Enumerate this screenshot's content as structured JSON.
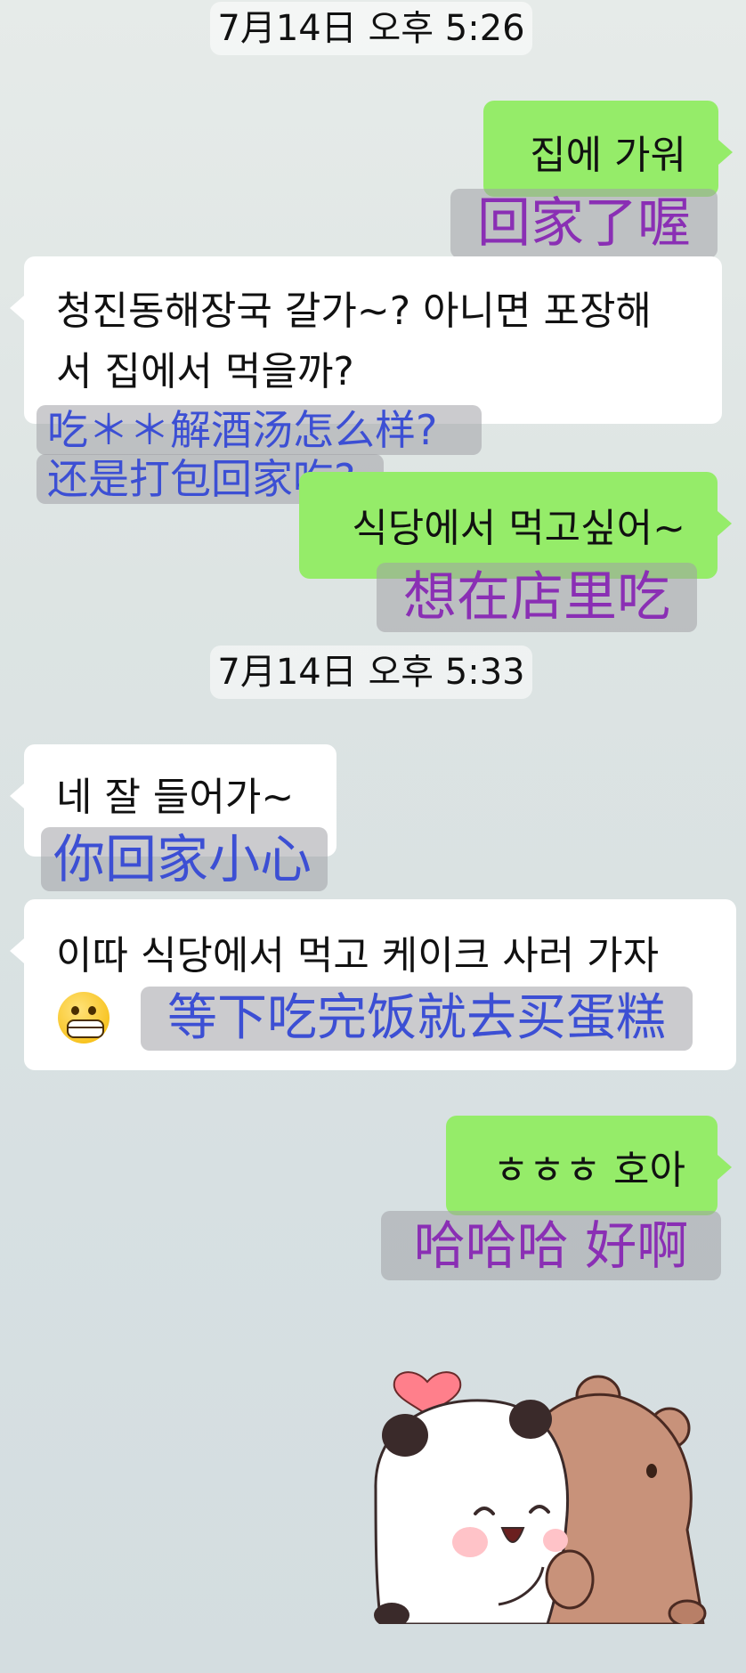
{
  "timestamps": [
    "7月14日 오후 5:26",
    "7月14日 오후 5:33"
  ],
  "messages": [
    {
      "side": "me",
      "text": "집에 가워",
      "translation": "回家了喔"
    },
    {
      "side": "them",
      "text_line1": "청진동해장국 갈가~? 아니면 포장해",
      "text_line2": "서 집에서 먹을까?",
      "translation_line1": "吃＊＊解酒汤怎么样?",
      "translation_line2": "还是打包回家吃?"
    },
    {
      "side": "me",
      "text": "식당에서 먹고싶어~",
      "translation": "想在店里吃"
    },
    {
      "side": "them",
      "text": "네 잘 들어가~",
      "translation": "你回家小心"
    },
    {
      "side": "them",
      "text": "이따 식당에서 먹고 케이크 사러 가자",
      "emoji": "grimacing-face-icon",
      "translation": "等下吃完饭就去买蛋糕"
    },
    {
      "side": "me",
      "text": "ㅎㅎㅎ 호아",
      "translation": "哈哈哈 好啊"
    }
  ],
  "sticker": "panda-and-bear-hug-sticker",
  "colors": {
    "my_bubble": "#95ec69",
    "their_bubble": "#ffffff",
    "translation_purple": "#8a2fb4",
    "translation_blue": "#3c4fd4"
  }
}
